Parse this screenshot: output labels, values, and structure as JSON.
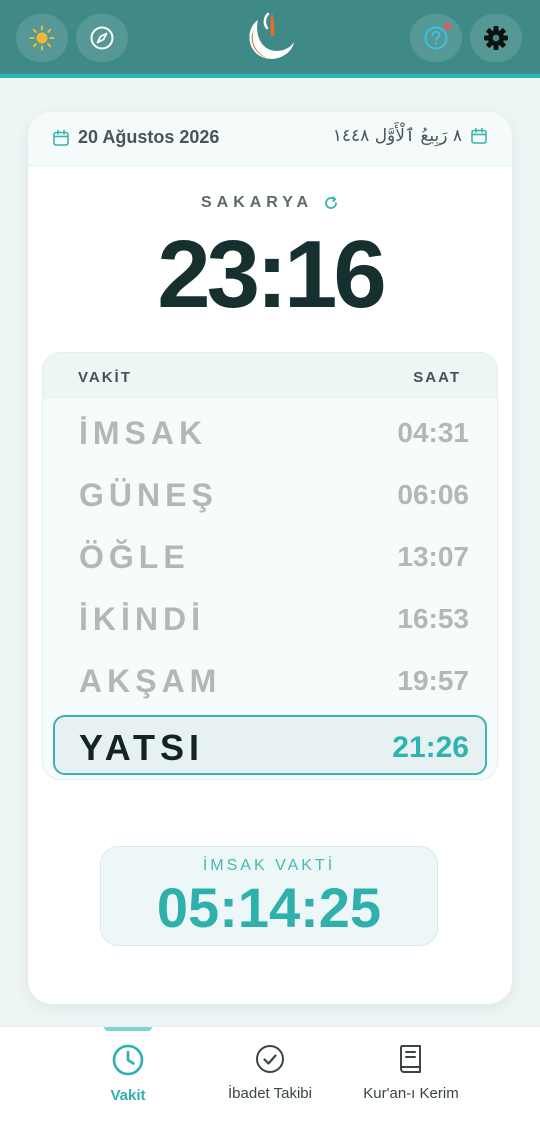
{
  "header": {
    "theme_icon": "sun-icon",
    "compass_icon": "compass-icon",
    "logo_icon": "crescent-logo-icon",
    "help_icon": "help-icon",
    "settings_icon": "gear-icon",
    "accent": "#3f8a87"
  },
  "dates": {
    "gregorian": "20 Ağustos 2026",
    "hijri": "٨ رَبِيعُ ٱلْأَوَّل ١٤٤٨"
  },
  "location": {
    "city": "SAKARYA",
    "refresh_icon": "refresh-icon"
  },
  "clock": {
    "time": "23:16"
  },
  "times": {
    "col_name": "VAKİT",
    "col_time": "SAAT",
    "rows": [
      {
        "name": "İMSAK",
        "time": "04:31"
      },
      {
        "name": "GÜNEŞ",
        "time": "06:06"
      },
      {
        "name": "ÖĞLE",
        "time": "13:07"
      },
      {
        "name": "İKİNDİ",
        "time": "16:53"
      },
      {
        "name": "AKŞAM",
        "time": "19:57"
      },
      {
        "name": "YATSI",
        "time": "21:26"
      }
    ],
    "active_index": 5
  },
  "countdown": {
    "label": "İMSAK VAKTİ",
    "value": "05:14:25"
  },
  "nav": {
    "items": [
      {
        "label": "Vakit",
        "icon": "clock-icon"
      },
      {
        "label": "İbadet Takibi",
        "icon": "check-circle-icon"
      },
      {
        "label": "Kur'an-ı Kerim",
        "icon": "book-icon"
      }
    ],
    "active_index": 0
  }
}
